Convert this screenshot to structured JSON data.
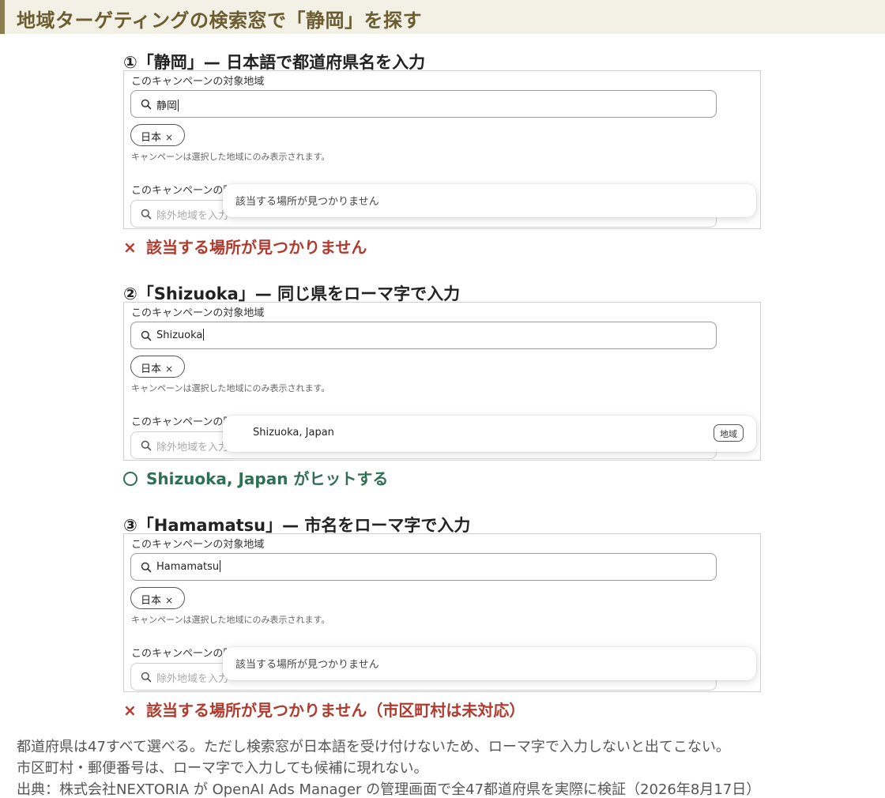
{
  "title": "地域ターゲティングの検索窓で「静岡」を探す",
  "ui": {
    "target_label": "このキャンペーンの対象地域",
    "chip_label": "日本",
    "chip_remove": "×",
    "note": "キャンペーンは選択した地域にのみ表示されます。",
    "exclude_label": "このキャンペーンの除",
    "exclude_placeholder": "除外地域を入力"
  },
  "steps": [
    {
      "heading": "①「静岡」— 日本語で都道府県名を入力",
      "query": "静岡",
      "dropdown_message": "該当する場所が見つかりません",
      "verdict_mark": "×",
      "verdict": "該当する場所が見つかりません"
    },
    {
      "heading": "②「Shizuoka」— 同じ県をローマ字で入力",
      "query": "Shizuoka",
      "dropdown_result": "Shizuoka, Japan",
      "dropdown_tag": "地域",
      "verdict": "Shizuoka, Japan がヒットする"
    },
    {
      "heading": "③「Hamamatsu」— 市名をローマ字で入力",
      "query": "Hamamatsu",
      "dropdown_message": "該当する場所が見つかりません",
      "verdict_mark": "×",
      "verdict": "該当する場所が見つかりません（市区町村は未対応）"
    }
  ],
  "footer": {
    "line1": "都道府県は47すべて選べる。ただし検索窓が日本語を受け付けないため、ローマ字で入力しないと出てこない。",
    "line2": "市区町村・郵便番号は、ローマ字で入力しても候補に現れない。",
    "line3": "出典：株式会社NEXTORIA が OpenAI Ads Manager の管理画面で全47都道府県を実際に検証（2026年8月17日）"
  },
  "colors": {
    "title_bg": "#f3f0e6",
    "title_accent": "#8d7e4e",
    "title_text": "#6b5d2f",
    "ng": "#b03a2e",
    "ok": "#2f6f53"
  }
}
